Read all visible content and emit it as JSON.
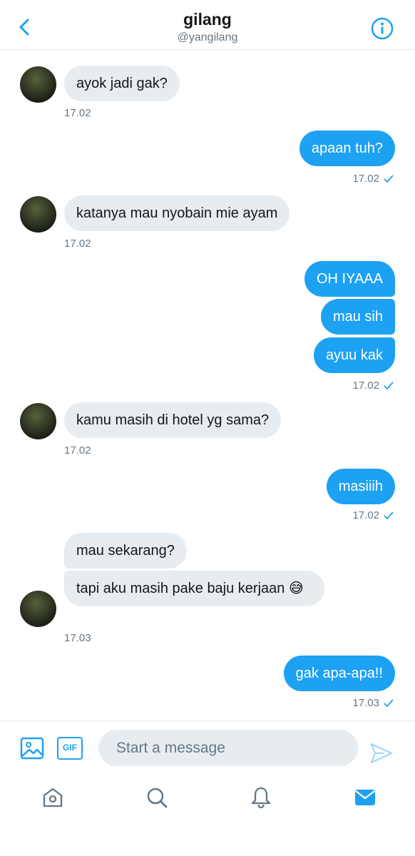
{
  "header": {
    "title": "gilang",
    "handle": "@yangilang"
  },
  "messages": [
    {
      "direction": "in",
      "text": "ayok jadi gak?",
      "time": "17.02"
    },
    {
      "direction": "out",
      "text": "apaan tuh?",
      "time": "17.02"
    },
    {
      "direction": "in",
      "text": "katanya mau nyobain mie ayam",
      "time": "17.02"
    },
    {
      "direction": "out",
      "text": "OH IYAAA"
    },
    {
      "direction": "out",
      "text": "mau sih"
    },
    {
      "direction": "out",
      "text": "ayuu kak",
      "time": "17.02"
    },
    {
      "direction": "in",
      "text": "kamu masih di hotel yg sama?",
      "time": "17.02"
    },
    {
      "direction": "out",
      "text": "masiiih",
      "time": "17.02"
    },
    {
      "direction": "in",
      "text": "mau sekarang?"
    },
    {
      "direction": "in",
      "text": "tapi aku masih pake baju kerjaan 😅",
      "time": "17.03"
    },
    {
      "direction": "out",
      "text": "gak apa-apa!!",
      "time": "17.03"
    }
  ],
  "composer": {
    "placeholder": "Start a message",
    "gif_label": "GIF"
  },
  "colors": {
    "accent": "#1da1f2",
    "incoming_bubble": "#e6ecf0",
    "muted_text": "#657786"
  },
  "icons": [
    "back-arrow-icon",
    "info-icon",
    "image-icon",
    "gif-icon",
    "send-icon",
    "home-icon",
    "search-icon",
    "bell-icon",
    "mail-icon",
    "read-check-icon"
  ]
}
